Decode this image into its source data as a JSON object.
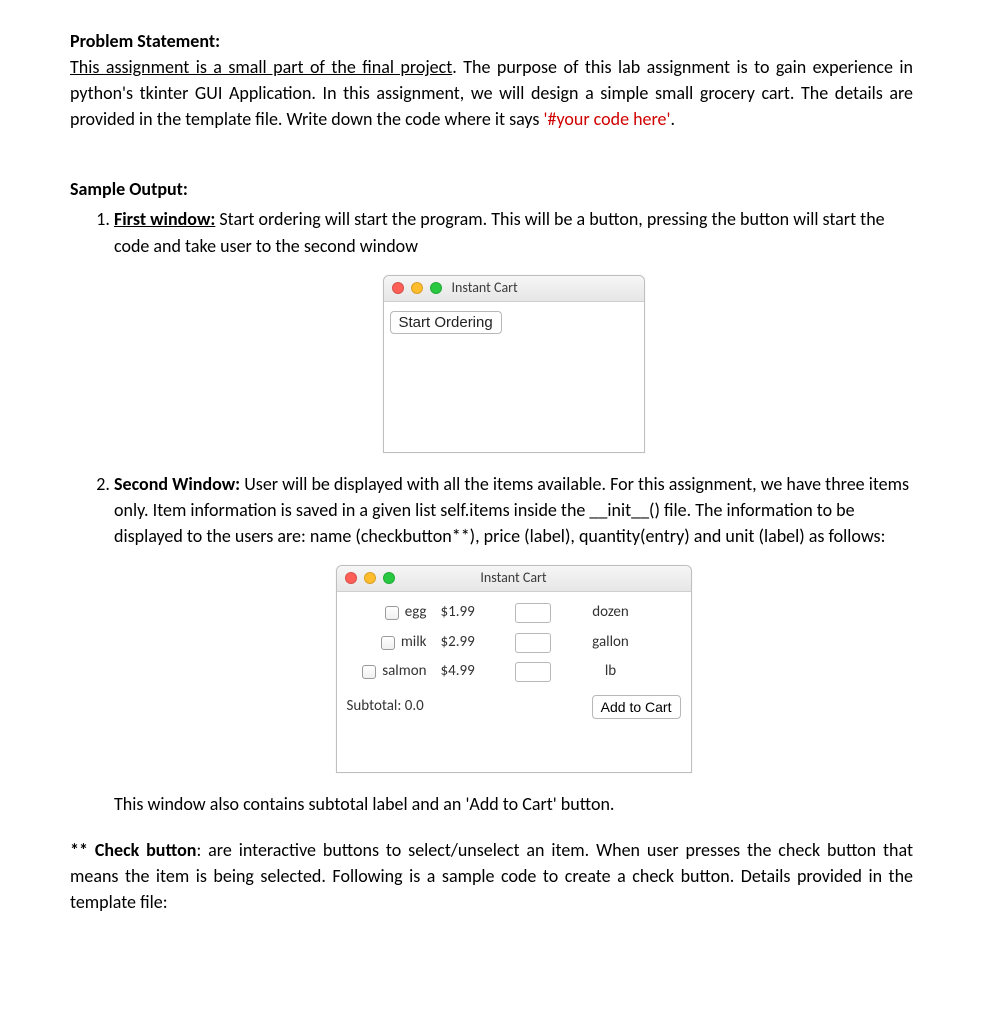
{
  "heading1": "Problem Statement:",
  "para1a": "This assignment is a small part of the final project",
  "para1b": ". The purpose of this lab assignment is to gain experience in python's tkinter GUI Application. In this assignment, we will design a simple small grocery cart. The details are provided in the template file. Write down the code where it says ",
  "para1c": "'#your code here'",
  "para1d": ".",
  "heading2": "Sample Output:",
  "item1": {
    "lead": "First window:",
    "rest": " Start ordering will start the program. This will be a button, pressing the button will start the code and take user to the second window"
  },
  "win1": {
    "title": "Instant Cart",
    "button": "Start Ordering"
  },
  "item2": {
    "lead": "Second Window:",
    "rest": " User will be displayed with all the items available. For this assignment, we have three items only. Item information is saved in a given list self.items inside the __init__() file. The information to be displayed to the users are: name (checkbutton**), price (label), quantity(entry) and unit (label) as follows:"
  },
  "win2": {
    "title": "Instant Cart",
    "rows": [
      {
        "name": "egg",
        "price": "$1.99",
        "unit": "dozen"
      },
      {
        "name": "milk",
        "price": "$2.99",
        "unit": "gallon"
      },
      {
        "name": "salmon",
        "price": "$4.99",
        "unit": "lb"
      }
    ],
    "subtotal_label": "Subtotal: 0.0",
    "add_button": "Add to Cart"
  },
  "after_win2": "This window also contains subtotal label and an 'Add to Cart' button.",
  "footnote_lead": "** Check button",
  "footnote_rest": ": are interactive buttons to select/unselect an item. When user presses the check button that means the item is being selected. Following is a sample code to create a check button. Details provided in the template file:"
}
